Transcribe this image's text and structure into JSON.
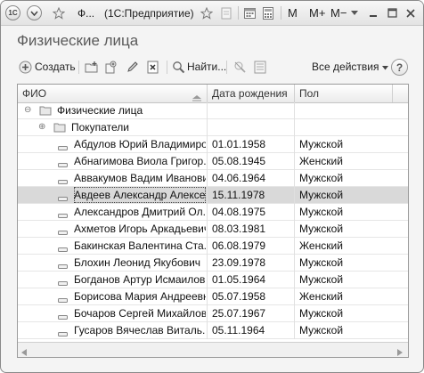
{
  "titlebar": {
    "logo": "1С",
    "title": "Ф...",
    "app": "(1С:Предприятие)",
    "m": "M",
    "m_plus": "M+",
    "m_minus": "M−"
  },
  "page": {
    "title": "Физические лица"
  },
  "toolbar": {
    "create": "Создать",
    "find": "Найти...",
    "all_actions": "Все действия",
    "help": "?"
  },
  "table": {
    "columns": [
      "ФИО",
      "Дата рождения",
      "Пол"
    ],
    "groups": [
      {
        "name": "Физические лица",
        "toggle": "⊖"
      },
      {
        "name": "Покупатели",
        "toggle": "⊕"
      }
    ],
    "rows": [
      {
        "name": "Абдулов Юрий Владимиро...",
        "date": "01.01.1958",
        "sex": "Мужской"
      },
      {
        "name": "Абнагимова Виола Григор...",
        "date": "05.08.1945",
        "sex": "Женский"
      },
      {
        "name": "Аввакумов Вадим Иванович",
        "date": "04.06.1964",
        "sex": "Мужской"
      },
      {
        "name": "Авдеев Александр Алексе...",
        "date": "15.11.1978",
        "sex": "Мужской",
        "selected": true
      },
      {
        "name": "Александров Дмитрий Ол...",
        "date": "04.08.1975",
        "sex": "Мужской"
      },
      {
        "name": "Ахметов Игорь Аркадьевич",
        "date": "08.03.1981",
        "sex": "Мужской"
      },
      {
        "name": "Бакинская Валентина Ста...",
        "date": "06.08.1979",
        "sex": "Женский"
      },
      {
        "name": "Блохин Леонид Якубович",
        "date": "23.09.1978",
        "sex": "Мужской"
      },
      {
        "name": "Богданов Артур Исмаилов...",
        "date": "01.05.1964",
        "sex": "Мужской"
      },
      {
        "name": "Борисова Мария Андреевна",
        "date": "05.07.1958",
        "sex": "Женский"
      },
      {
        "name": "Бочаров Сергей Михайлов...",
        "date": "25.07.1967",
        "sex": "Мужской"
      },
      {
        "name": "Гусаров Вячеслав Виталь...",
        "date": "05.11.1964",
        "sex": "Мужской"
      }
    ]
  },
  "colors": {
    "selected_row": "#d9d9d9",
    "title_text": "#5a5a5a"
  }
}
